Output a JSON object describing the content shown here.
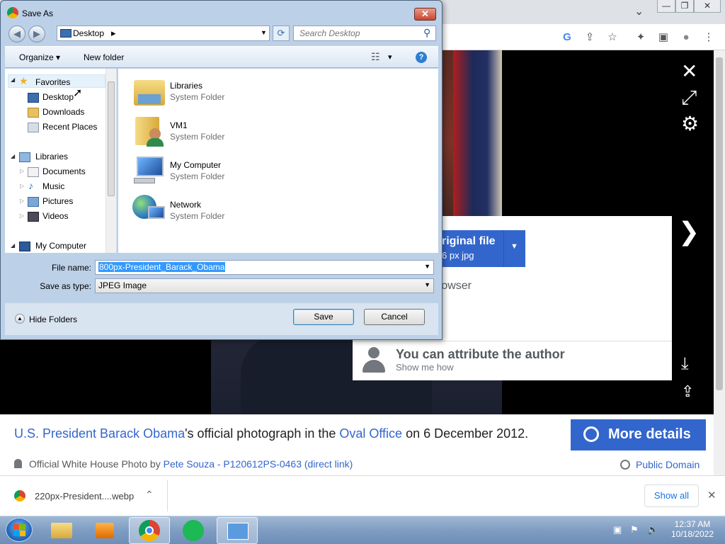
{
  "chrome": {
    "minimize_glyph": "—",
    "restore_glyph": "❐",
    "close_glyph": "✕",
    "tab_menu_glyph": "⌄",
    "toolbar_icons": [
      "G",
      "⇪",
      "☆",
      "✦",
      "▣",
      "●",
      "⋮"
    ]
  },
  "viewer": {
    "close_glyph": "✕",
    "expand_glyph": "⤢",
    "settings_glyph": "⚙",
    "next_glyph": "❯",
    "download_glyph": "⤓",
    "share_glyph": "⇪",
    "download_button": {
      "main": "riginal file",
      "sub": "6 px jpg",
      "caret": "▼"
    },
    "browser_text": "rowser",
    "attribution": {
      "title": "You can attribute the author",
      "link": "Show me how"
    },
    "caption": {
      "part1": "U.S. President Barack Obama",
      "part2": "'s official photograph in the ",
      "part3": "Oval Office",
      "part4": " on 6 December 2012."
    },
    "more_details": "More details",
    "credit": {
      "prefix": "Official White House Photo by ",
      "author": "Pete Souza - P120612PS-0463",
      "suffix_link": "(direct link)"
    },
    "license": "Public Domain"
  },
  "download_bar": {
    "filename": "220px-President....webp",
    "chevron": "⌃",
    "show_all": "Show all",
    "close": "✕"
  },
  "dialog": {
    "title": "Save As",
    "close": "✕",
    "back_glyph": "◀",
    "forward_glyph": "▶",
    "address_location": "Desktop",
    "address_arrow": "▸",
    "address_dropdown": "▼",
    "refresh_glyph": "⟳",
    "search_placeholder": "Search Desktop",
    "search_glyph": "⚲",
    "organize": "Organize",
    "organize_caret": "▾",
    "new_folder": "New folder",
    "views_glyph": "☷",
    "views_caret": "▾",
    "help_glyph": "?",
    "nav": {
      "favorites": "Favorites",
      "desktop": "Desktop",
      "downloads": "Downloads",
      "recent_places": "Recent Places",
      "libraries": "Libraries",
      "documents": "Documents",
      "music": "Music",
      "pictures": "Pictures",
      "videos": "Videos",
      "my_computer": "My Computer"
    },
    "files": [
      {
        "name": "Libraries",
        "type": "System Folder"
      },
      {
        "name": "VM1",
        "type": "System Folder"
      },
      {
        "name": "My Computer",
        "type": "System Folder"
      },
      {
        "name": "Network",
        "type": "System Folder"
      }
    ],
    "file_name_label": "File name:",
    "file_name_value": "800px-President_Barack_Obama",
    "save_type_label": "Save as type:",
    "save_type_value": "JPEG Image",
    "hide_folders": "Hide Folders",
    "save": "Save",
    "cancel": "Cancel"
  },
  "taskbar": {
    "clock_time": "12:37 AM",
    "clock_date": "10/18/2022"
  },
  "colors": {
    "accent": "#3366cc",
    "dialog_frame": "#bcd0e7",
    "taskbar": "#7f9dc3"
  }
}
